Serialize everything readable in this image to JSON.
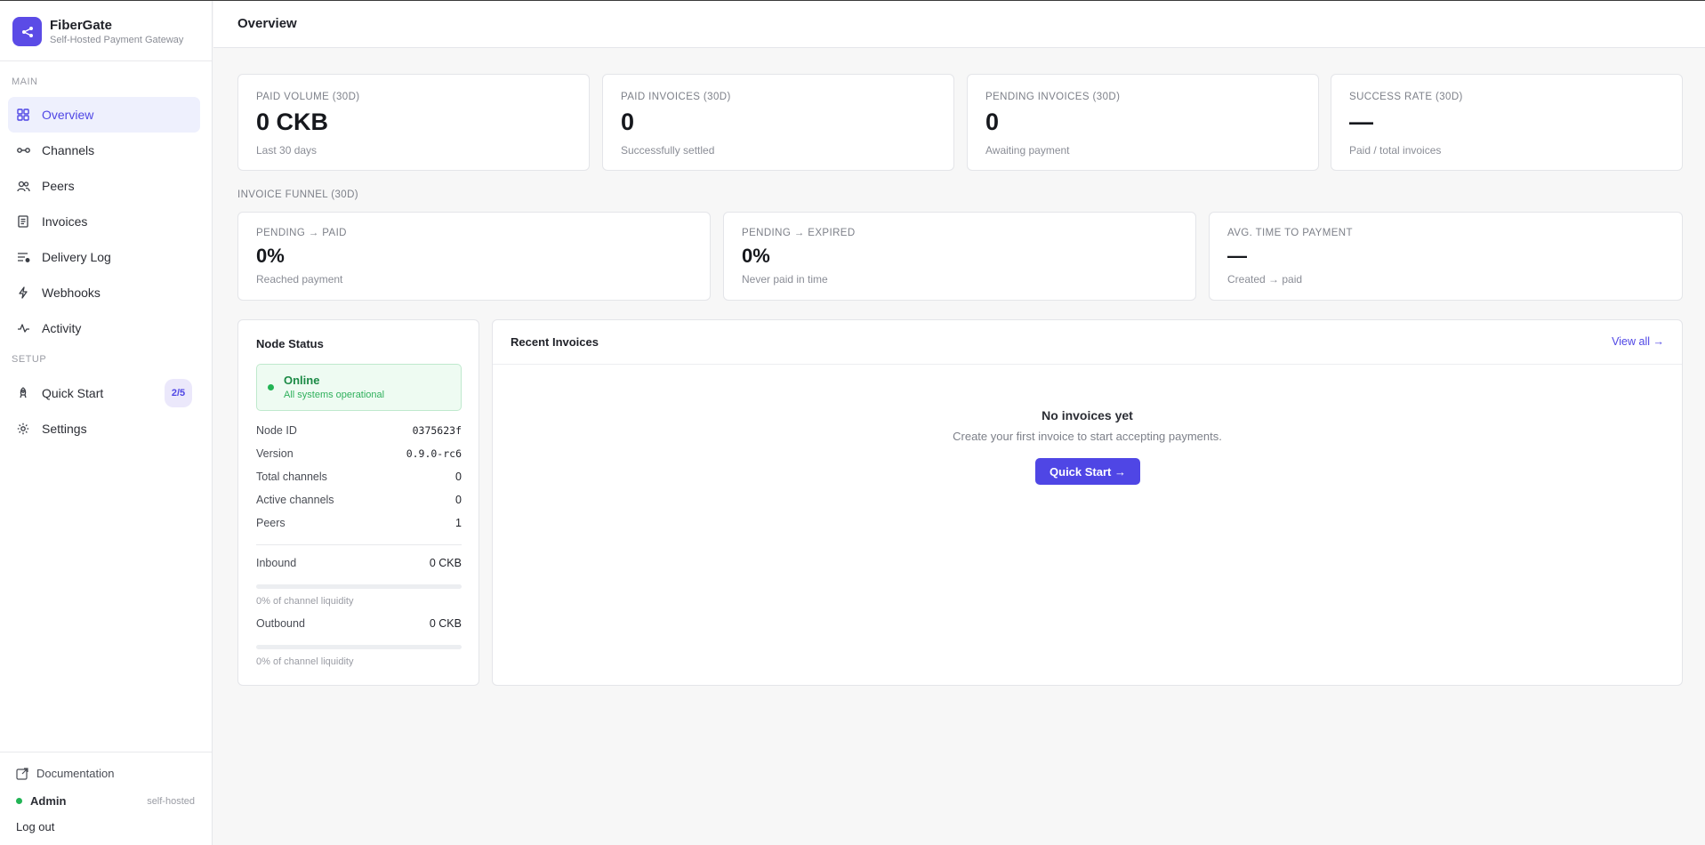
{
  "brand": {
    "name": "FiberGate",
    "subtitle": "Self-Hosted Payment Gateway"
  },
  "sidebar": {
    "main_label": "MAIN",
    "setup_label": "SETUP",
    "main_items": [
      {
        "label": "Overview",
        "icon": "grid-icon",
        "active": true
      },
      {
        "label": "Channels",
        "icon": "link-icon"
      },
      {
        "label": "Peers",
        "icon": "users-icon"
      },
      {
        "label": "Invoices",
        "icon": "file-text-icon"
      },
      {
        "label": "Delivery Log",
        "icon": "list-icon"
      },
      {
        "label": "Webhooks",
        "icon": "zap-icon"
      },
      {
        "label": "Activity",
        "icon": "activity-icon"
      }
    ],
    "setup_items": [
      {
        "label": "Quick Start",
        "icon": "rocket-icon",
        "badge": "2/5"
      },
      {
        "label": "Settings",
        "icon": "gear-icon"
      }
    ],
    "footer": {
      "documentation": "Documentation",
      "user": "Admin",
      "mode": "self-hosted",
      "logout": "Log out"
    }
  },
  "header": {
    "title": "Overview"
  },
  "kpis": [
    {
      "label": "PAID VOLUME (30D)",
      "value": "0 CKB",
      "sub": "Last 30 days"
    },
    {
      "label": "PAID INVOICES (30D)",
      "value": "0",
      "sub": "Successfully settled"
    },
    {
      "label": "PENDING INVOICES (30D)",
      "value": "0",
      "sub": "Awaiting payment"
    },
    {
      "label": "SUCCESS RATE (30D)",
      "value": "—",
      "sub": "Paid / total invoices"
    }
  ],
  "funnel": {
    "heading": "INVOICE FUNNEL (30D)",
    "cards": [
      {
        "label": "PENDING → PAID",
        "value": "0%",
        "sub": "Reached payment"
      },
      {
        "label": "PENDING → EXPIRED",
        "value": "0%",
        "sub": "Never paid in time"
      },
      {
        "label": "AVG. TIME TO PAYMENT",
        "value": "—",
        "sub": "Created → paid"
      }
    ]
  },
  "node_status": {
    "title": "Node Status",
    "status": "Online",
    "status_sub": "All systems operational",
    "rows": [
      {
        "key": "Node ID",
        "value": "0375623f"
      },
      {
        "key": "Version",
        "value": "0.9.0-rc6"
      },
      {
        "key": "Total channels",
        "value": "0"
      },
      {
        "key": "Active channels",
        "value": "0"
      },
      {
        "key": "Peers",
        "value": "1"
      }
    ],
    "inbound": {
      "label": "Inbound",
      "value": "0 CKB",
      "note": "0% of channel liquidity",
      "percent": 0
    },
    "outbound": {
      "label": "Outbound",
      "value": "0 CKB",
      "note": "0% of channel liquidity",
      "percent": 0
    }
  },
  "recent_invoices": {
    "title": "Recent Invoices",
    "view_all": "View all →",
    "empty_title": "No invoices yet",
    "empty_sub": "Create your first invoice to start accepting payments.",
    "cta": "Quick Start →"
  },
  "colors": {
    "accent": "#4f46e5",
    "online": "#22b455"
  }
}
